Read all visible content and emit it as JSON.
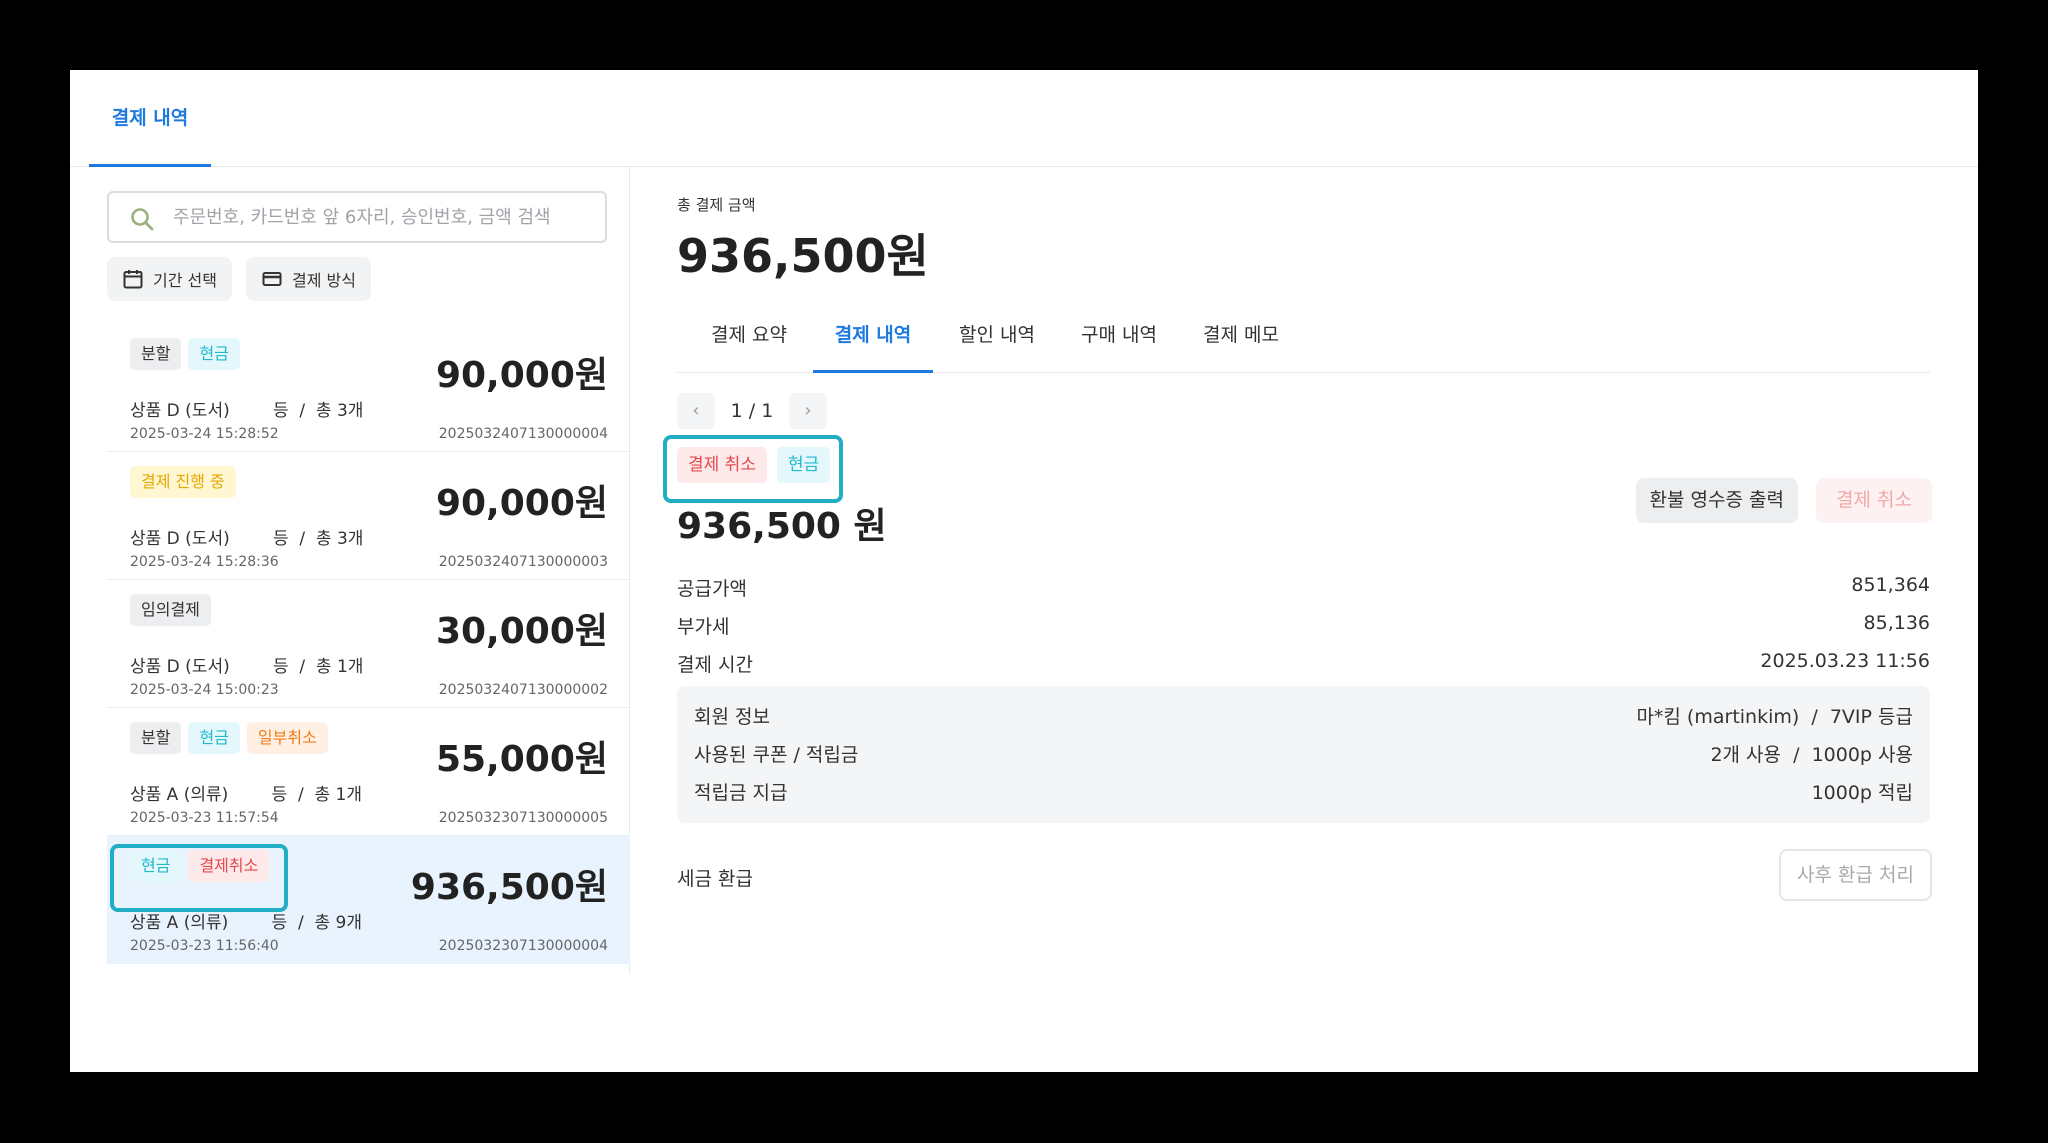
{
  "top_tab": {
    "label": "결제 내역"
  },
  "search": {
    "placeholder": "주문번호, 카드번호 앞 6자리, 승인번호, 금액 검색"
  },
  "filters": {
    "period_label": "기간 선택",
    "method_label": "결제 방식"
  },
  "orders": [
    {
      "tags": [
        "분할",
        "현금"
      ],
      "amount": "90,000원",
      "product": "상품 D (도서)        등  /  총 3개",
      "date": "2025-03-24 15:28:52",
      "order_no": "2025032407130000004"
    },
    {
      "tags": [
        "결제 진행 중"
      ],
      "amount": "90,000원",
      "product": "상품 D (도서)        등  /  총 3개",
      "date": "2025-03-24 15:28:36",
      "order_no": "2025032407130000003"
    },
    {
      "tags": [
        "임의결제"
      ],
      "amount": "30,000원",
      "product": "상품 D (도서)        등  /  총 1개",
      "date": "2025-03-24 15:00:23",
      "order_no": "2025032407130000002"
    },
    {
      "tags": [
        "분할",
        "현금",
        "일부취소"
      ],
      "amount": "55,000원",
      "product": "상품 A (의류)        등  /  총 1개",
      "date": "2025-03-23 11:57:54",
      "order_no": "2025032307130000005"
    },
    {
      "tags": [
        "현금",
        "결제취소"
      ],
      "amount": "936,500원",
      "product": "상품 A (의류)        등  /  총 9개",
      "date": "2025-03-23 11:56:40",
      "order_no": "2025032307130000004"
    }
  ],
  "detail": {
    "total_label": "총 결제 금액",
    "total_amount": "936,500원",
    "tabs": [
      "결제 요약",
      "결제 내역",
      "할인 내역",
      "구매 내역",
      "결제 메모"
    ],
    "pager": {
      "prev": "‹",
      "text": "1 / 1",
      "next": "›"
    },
    "tags": [
      "결제 취소",
      "현금"
    ],
    "amount": "936,500 원",
    "receipt_button": "환불 영수증 출력",
    "cancel_button": "결제 취소",
    "supply_label": "공급가액",
    "supply_value": "851,364",
    "vat_label": "부가세",
    "vat_value": "85,136",
    "time_label": "결제 시간",
    "time_value": "2025.03.23 11:56",
    "member_label": "회원 정보",
    "member_value": "마*킴 (martinkim)  /  7VIP 등급",
    "coupon_label": "사용된 쿠폰 / 적립금",
    "coupon_value": "2개 사용  /  1000p 사용",
    "points_label": "적립금 지급",
    "points_value": "1000p 적립",
    "tax_label": "세금 환급",
    "tax_button": "사후 환급 처리"
  },
  "colors": {
    "accent": "#1f7ae0",
    "highlight": "#20aec4",
    "selected_row": "#e8f3fd",
    "cancel_red": "#e5484d",
    "cash_cyan": "#22b8cf"
  }
}
